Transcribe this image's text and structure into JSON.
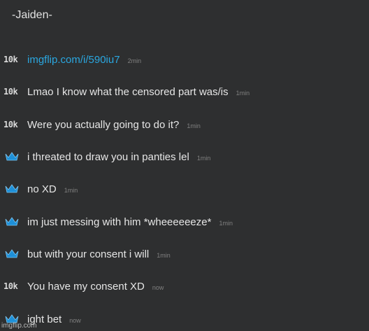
{
  "header": {
    "title": "-Jaiden-"
  },
  "colors": {
    "background": "#2e2f30",
    "link": "#2aa7e0",
    "crown": "#1e90d8"
  },
  "messages": [
    {
      "badge": "10k",
      "text": "imgflip.com/i/590iu7",
      "time": "2min",
      "is_link": true
    },
    {
      "badge": "10k",
      "text": "Lmao I know what the censored part was/is",
      "time": "1min"
    },
    {
      "badge": "10k",
      "text": "Were you actually going to do it?",
      "time": "1min"
    },
    {
      "badge": "crown-icon",
      "text": "i threated to draw you in panties lel",
      "time": "1min"
    },
    {
      "badge": "crown-icon",
      "text": "no XD",
      "time": "1min"
    },
    {
      "badge": "crown-icon",
      "text": "im just messing with him *wheeeeeeze*",
      "time": "1min"
    },
    {
      "badge": "crown-icon",
      "text": "but with your consent i will",
      "time": "1min"
    },
    {
      "badge": "10k",
      "text": "You have my consent XD",
      "time": "now"
    },
    {
      "badge": "crown-icon",
      "text": "ight bet",
      "time": "now"
    }
  ],
  "watermark": "imgflip.com"
}
